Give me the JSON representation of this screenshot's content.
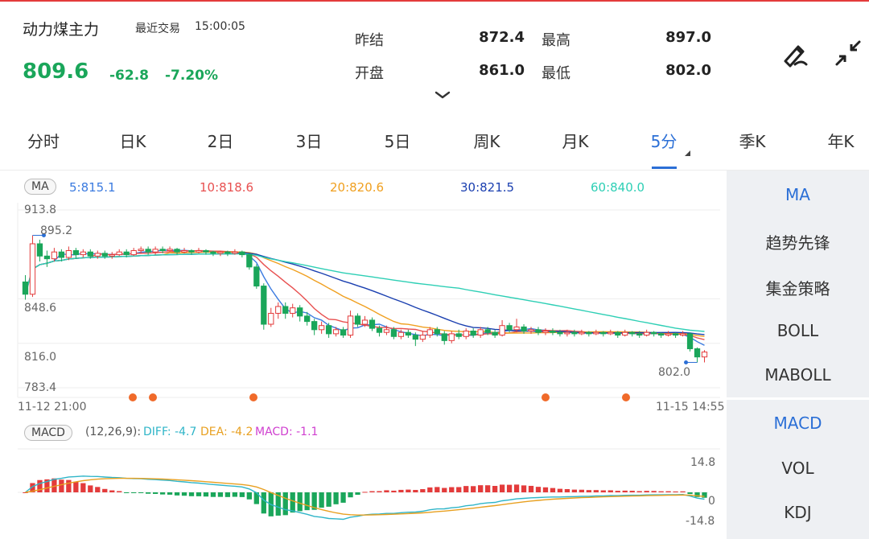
{
  "header": {
    "name": "动力煤主力",
    "trade_label": "最近交易",
    "trade_time": "15:00:05",
    "price": "809.6",
    "change": "-62.8",
    "change_pct": "-7.20%",
    "stats": [
      {
        "label": "昨结",
        "value": "872.4"
      },
      {
        "label": "最高",
        "value": "897.0"
      },
      {
        "label": "开盘",
        "value": "861.0"
      },
      {
        "label": "最低",
        "value": "802.0"
      }
    ],
    "icons": [
      "draw-pen-icon",
      "collapse-arrows-icon",
      "chevron-down-icon"
    ]
  },
  "tabs": [
    {
      "label": "分时"
    },
    {
      "label": "日K"
    },
    {
      "label": "2日"
    },
    {
      "label": "3日"
    },
    {
      "label": "5日"
    },
    {
      "label": "周K"
    },
    {
      "label": "月K"
    },
    {
      "label": "5分"
    },
    {
      "label": "季K"
    },
    {
      "label": "年K"
    }
  ],
  "active_tab": "5分",
  "ma_bar": {
    "tag": "MA",
    "items": [
      {
        "text": "5:815.1",
        "color": "#3b7be0"
      },
      {
        "text": "10:818.6",
        "color": "#e85050"
      },
      {
        "text": "20:820.6",
        "color": "#f0a020"
      },
      {
        "text": "30:821.5",
        "color": "#1a3fb0"
      },
      {
        "text": "60:840.0",
        "color": "#2ecfb5"
      }
    ]
  },
  "price_axis": [
    "913.8",
    "848.6",
    "816.0",
    "783.4"
  ],
  "high_marker": "895.2",
  "low_marker": "802.0",
  "time_start": "11-12 21:00",
  "time_end": "11-15 14:55",
  "macd_bar": {
    "tag": "MACD",
    "params": "(12,26,9):",
    "diff": "DIFF: -4.7",
    "dea": "DEA: -4.2",
    "macd": "MACD: -1.1",
    "colors": {
      "diff": "#2fb5c8",
      "dea": "#e8a020",
      "macd": "#d040d0"
    }
  },
  "macd_axis": [
    "14.8",
    "0",
    "-14.8"
  ],
  "side_indicators": [
    "MA",
    "趋势先锋",
    "集金策略",
    "BOLL",
    "MABOLL"
  ],
  "side_sub_indicators": [
    "MACD",
    "VOL",
    "KDJ"
  ],
  "colors": {
    "up": "#e33b3b",
    "down": "#1aa65a",
    "accent": "#2b6fd6",
    "event_dot": "#f06a2a"
  },
  "chart_data": {
    "type": "candlestick",
    "interval": "5分",
    "ylim": [
      783.4,
      913.8
    ],
    "candles": [
      [
        861.0,
        852.0,
        866.0,
        848.0
      ],
      [
        852.0,
        889.0,
        895.2,
        850.0
      ],
      [
        889.0,
        880.0,
        892.0,
        876.0
      ],
      [
        880.0,
        878.0,
        884.0,
        872.0
      ],
      [
        878.0,
        883.0,
        886.0,
        876.0
      ],
      [
        883.0,
        879.0,
        885.0,
        876.0
      ],
      [
        879.0,
        884.0,
        887.0,
        877.0
      ],
      [
        884.0,
        881.0,
        886.0,
        878.0
      ],
      [
        881.0,
        883.0,
        885.0,
        879.0
      ],
      [
        883.0,
        880.0,
        885.0,
        878.0
      ],
      [
        880.0,
        882.0,
        884.0,
        878.0
      ],
      [
        882.0,
        880.0,
        884.0,
        878.0
      ],
      [
        880.0,
        881.0,
        883.0,
        878.0
      ],
      [
        881.0,
        883.0,
        885.0,
        880.0
      ],
      [
        883.0,
        881.0,
        885.0,
        879.0
      ],
      [
        881.0,
        884.0,
        886.0,
        880.0
      ],
      [
        884.0,
        885.0,
        887.0,
        882.0
      ],
      [
        885.0,
        883.0,
        887.0,
        881.0
      ],
      [
        883.0,
        885.0,
        887.0,
        881.0
      ],
      [
        885.0,
        884.0,
        887.0,
        882.0
      ],
      [
        884.0,
        885.0,
        887.0,
        883.0
      ],
      [
        885.0,
        883.0,
        886.0,
        881.0
      ],
      [
        883.0,
        884.0,
        886.0,
        882.0
      ],
      [
        884.0,
        883.0,
        885.0,
        881.0
      ],
      [
        883.0,
        884.0,
        886.0,
        882.0
      ],
      [
        884.0,
        883.0,
        885.0,
        881.0
      ],
      [
        883.0,
        882.0,
        884.0,
        880.0
      ],
      [
        882.0,
        883.0,
        884.0,
        880.0
      ],
      [
        883.0,
        882.0,
        884.0,
        880.0
      ],
      [
        882.0,
        883.0,
        885.0,
        881.0
      ],
      [
        883.0,
        881.0,
        884.0,
        879.0
      ],
      [
        881.0,
        872.0,
        882.0,
        870.0
      ],
      [
        872.0,
        858.0,
        874.0,
        856.0
      ],
      [
        858.0,
        830.0,
        860.0,
        826.0
      ],
      [
        830.0,
        838.0,
        842.0,
        828.0
      ],
      [
        838.0,
        843.0,
        846.0,
        834.0
      ],
      [
        843.0,
        838.0,
        846.0,
        834.0
      ],
      [
        838.0,
        842.0,
        845.0,
        835.0
      ],
      [
        842.0,
        836.0,
        844.0,
        832.0
      ],
      [
        836.0,
        832.0,
        839.0,
        829.0
      ],
      [
        832.0,
        826.0,
        834.0,
        822.0
      ],
      [
        826.0,
        829.0,
        832.0,
        823.0
      ],
      [
        829.0,
        823.0,
        831.0,
        820.0
      ],
      [
        823.0,
        826.0,
        828.0,
        821.0
      ],
      [
        826.0,
        822.0,
        828.0,
        820.0
      ],
      [
        822.0,
        836.0,
        840.0,
        820.0
      ],
      [
        836.0,
        830.0,
        838.0,
        828.0
      ],
      [
        830.0,
        833.0,
        836.0,
        828.0
      ],
      [
        833.0,
        827.0,
        835.0,
        825.0
      ],
      [
        827.0,
        824.0,
        829.0,
        821.0
      ],
      [
        824.0,
        826.0,
        829.0,
        822.0
      ],
      [
        826.0,
        821.0,
        828.0,
        819.0
      ],
      [
        821.0,
        824.0,
        826.0,
        819.0
      ],
      [
        824.0,
        822.0,
        826.0,
        820.0
      ],
      [
        822.0,
        819.0,
        824.0,
        814.0
      ],
      [
        819.0,
        822.0,
        825.0,
        817.0
      ],
      [
        822.0,
        826.0,
        828.0,
        820.0
      ],
      [
        826.0,
        823.0,
        828.0,
        821.0
      ],
      [
        823.0,
        818.0,
        825.0,
        815.0
      ],
      [
        818.0,
        823.0,
        825.0,
        816.0
      ],
      [
        823.0,
        821.0,
        826.0,
        819.0
      ],
      [
        821.0,
        825.0,
        827.0,
        819.0
      ],
      [
        825.0,
        822.0,
        827.0,
        820.0
      ],
      [
        822.0,
        826.0,
        828.0,
        820.0
      ],
      [
        826.0,
        824.0,
        828.0,
        822.0
      ],
      [
        824.0,
        822.0,
        826.0,
        820.0
      ],
      [
        822.0,
        829.0,
        833.0,
        821.0
      ],
      [
        829.0,
        826.0,
        831.0,
        824.0
      ],
      [
        826.0,
        828.0,
        834.0,
        824.0
      ],
      [
        828.0,
        825.0,
        830.0,
        823.0
      ],
      [
        825.0,
        826.0,
        828.0,
        823.0
      ],
      [
        826.0,
        824.0,
        828.0,
        822.0
      ],
      [
        824.0,
        825.0,
        827.0,
        822.0
      ],
      [
        825.0,
        824.0,
        827.0,
        822.0
      ],
      [
        824.0,
        823.0,
        826.0,
        821.0
      ],
      [
        823.0,
        824.0,
        826.0,
        821.0
      ],
      [
        824.0,
        823.0,
        826.0,
        821.0
      ],
      [
        823.0,
        824.0,
        826.0,
        822.0
      ],
      [
        824.0,
        823.0,
        825.0,
        821.0
      ],
      [
        823.0,
        824.0,
        826.0,
        822.0
      ],
      [
        824.0,
        823.0,
        825.0,
        821.0
      ],
      [
        823.0,
        824.0,
        826.0,
        822.0
      ],
      [
        824.0,
        822.0,
        825.0,
        820.0
      ],
      [
        822.0,
        824.0,
        826.0,
        821.0
      ],
      [
        824.0,
        823.0,
        825.0,
        821.0
      ],
      [
        823.0,
        822.0,
        825.0,
        820.0
      ],
      [
        822.0,
        824.0,
        826.0,
        821.0
      ],
      [
        824.0,
        823.0,
        825.0,
        821.0
      ],
      [
        823.0,
        822.0,
        824.0,
        820.0
      ],
      [
        822.0,
        823.0,
        825.0,
        821.0
      ],
      [
        823.0,
        822.0,
        824.0,
        820.0
      ],
      [
        822.0,
        823.0,
        825.0,
        821.0
      ],
      [
        823.0,
        812.0,
        824.0,
        810.0
      ],
      [
        812.0,
        806.0,
        813.0,
        802.0
      ],
      [
        806.0,
        809.6,
        811.0,
        802.0
      ]
    ]
  }
}
